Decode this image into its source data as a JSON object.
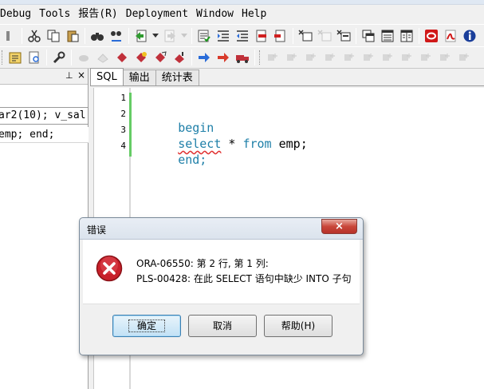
{
  "menubar": {
    "items": [
      "Debug",
      "Tools",
      "报告(R)",
      "Deployment",
      "Window",
      "Help"
    ]
  },
  "left_panel": {
    "pin_glyph": "⊥",
    "close_glyph": "×",
    "code_line_1": "ar2(10); v_sal",
    "code_line_2": "emp; end;"
  },
  "editor": {
    "tabs": [
      "SQL",
      "输出",
      "统计表"
    ],
    "active_tab": "SQL",
    "line_numbers": [
      "1",
      "2",
      "3",
      "4"
    ],
    "lines": {
      "l2_kw": "begin",
      "l3_kw_select": "select",
      "l3_star": " * ",
      "l3_kw_from": "from",
      "l3_rest": " emp;",
      "l4_kw": "end;"
    }
  },
  "dialog": {
    "title": "错误",
    "close_glyph": "×",
    "message_line_1": "ORA-06550: 第 2 行, 第 1 列:",
    "message_line_2": "PLS-00428: 在此 SELECT 语句中缺少 INTO 子句",
    "buttons": {
      "ok": "确定",
      "cancel": "取消",
      "help": "帮助(H)"
    }
  },
  "colors": {
    "keyword": "#1e7fa8",
    "error_icon": "#c8202a",
    "gutter_change_marker": "#66cc66"
  }
}
